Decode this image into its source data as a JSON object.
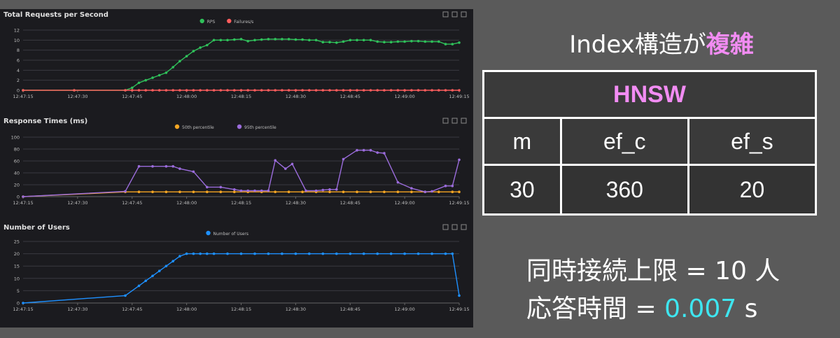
{
  "slide": {
    "title_prefix": "Index構造が",
    "title_highlight": "複雑",
    "table": {
      "header": "HNSW",
      "columns": [
        "m",
        "ef_c",
        "ef_s"
      ],
      "values": [
        "30",
        "360",
        "20"
      ]
    },
    "info1": "同時接続上限 = 10 人",
    "info2_prefix": "応答時間 = ",
    "info2_value": "0.007",
    "info2_suffix": " s"
  },
  "colors": {
    "rps": "#2fc15a",
    "failures": "#ff5d5d",
    "p50": "#f5a623",
    "p95": "#9b6cdc",
    "users": "#1e90ff",
    "highlight": "#f28cf3",
    "cyan": "#3ee6f0"
  },
  "chart_data": [
    {
      "type": "line",
      "title": "Total Requests per Second",
      "ylim": [
        0,
        12
      ],
      "yticks": [
        0,
        2,
        4,
        6,
        8,
        10,
        12
      ],
      "xticks": [
        "12:47:15",
        "12:47:30",
        "12:47:45",
        "12:48:00",
        "12:48:15",
        "12:48:30",
        "12:48:45",
        "12:49:00",
        "12:49:15"
      ],
      "grid": true,
      "legend": "top-center",
      "series": [
        {
          "name": "RPS",
          "color": "#2fc15a",
          "points": [
            [
              0,
              0
            ],
            [
              15,
              0
            ],
            [
              30,
              0
            ],
            [
              32,
              0.5
            ],
            [
              34,
              1.5
            ],
            [
              36,
              2
            ],
            [
              38,
              2.5
            ],
            [
              40,
              3
            ],
            [
              42,
              3.5
            ],
            [
              44,
              4.6
            ],
            [
              46,
              5.8
            ],
            [
              48,
              6.8
            ],
            [
              50,
              7.8
            ],
            [
              52,
              8.5
            ],
            [
              54,
              9
            ],
            [
              56,
              10
            ],
            [
              58,
              10
            ],
            [
              60,
              10
            ],
            [
              62,
              10.1
            ],
            [
              64,
              10.2
            ],
            [
              66,
              9.8
            ],
            [
              68,
              10
            ],
            [
              70,
              10.1
            ],
            [
              72,
              10.2
            ],
            [
              74,
              10.2
            ],
            [
              76,
              10.2
            ],
            [
              78,
              10.2
            ],
            [
              80,
              10.1
            ],
            [
              82,
              10.1
            ],
            [
              84,
              10
            ],
            [
              86,
              10
            ],
            [
              88,
              9.6
            ],
            [
              90,
              9.6
            ],
            [
              92,
              9.5
            ],
            [
              94,
              9.7
            ],
            [
              96,
              10
            ],
            [
              98,
              10
            ],
            [
              100,
              10
            ],
            [
              102,
              10
            ],
            [
              104,
              9.7
            ],
            [
              106,
              9.6
            ],
            [
              108,
              9.6
            ],
            [
              110,
              9.7
            ],
            [
              112,
              9.7
            ],
            [
              114,
              9.8
            ],
            [
              116,
              9.8
            ],
            [
              118,
              9.7
            ],
            [
              120,
              9.7
            ],
            [
              122,
              9.7
            ],
            [
              124,
              9.2
            ],
            [
              126,
              9.2
            ],
            [
              128,
              9.5
            ]
          ]
        },
        {
          "name": "Failures/s",
          "color": "#ff5d5d",
          "points": [
            [
              0,
              0
            ],
            [
              15,
              0
            ],
            [
              30,
              0
            ],
            [
              32,
              0
            ],
            [
              34,
              0
            ],
            [
              36,
              0
            ],
            [
              38,
              0
            ],
            [
              40,
              0
            ],
            [
              42,
              0
            ],
            [
              44,
              0
            ],
            [
              46,
              0
            ],
            [
              48,
              0
            ],
            [
              50,
              0
            ],
            [
              52,
              0
            ],
            [
              54,
              0
            ],
            [
              56,
              0
            ],
            [
              58,
              0
            ],
            [
              60,
              0
            ],
            [
              62,
              0
            ],
            [
              64,
              0
            ],
            [
              66,
              0
            ],
            [
              68,
              0
            ],
            [
              70,
              0
            ],
            [
              72,
              0
            ],
            [
              74,
              0
            ],
            [
              76,
              0
            ],
            [
              78,
              0
            ],
            [
              80,
              0
            ],
            [
              82,
              0
            ],
            [
              84,
              0
            ],
            [
              86,
              0
            ],
            [
              88,
              0
            ],
            [
              90,
              0
            ],
            [
              92,
              0
            ],
            [
              94,
              0
            ],
            [
              96,
              0
            ],
            [
              98,
              0
            ],
            [
              100,
              0
            ],
            [
              102,
              0
            ],
            [
              104,
              0
            ],
            [
              106,
              0
            ],
            [
              108,
              0
            ],
            [
              110,
              0
            ],
            [
              112,
              0
            ],
            [
              114,
              0
            ],
            [
              116,
              0
            ],
            [
              118,
              0
            ],
            [
              120,
              0
            ],
            [
              122,
              0
            ],
            [
              124,
              0
            ],
            [
              126,
              0
            ],
            [
              128,
              0
            ]
          ]
        }
      ]
    },
    {
      "type": "line",
      "title": "Response Times (ms)",
      "ylim": [
        0,
        100
      ],
      "yticks": [
        0,
        20,
        40,
        60,
        80,
        100
      ],
      "xticks": [
        "12:47:15",
        "12:47:30",
        "12:47:45",
        "12:48:00",
        "12:48:15",
        "12:48:30",
        "12:48:45",
        "12:49:00",
        "12:49:15"
      ],
      "grid": true,
      "legend": "top-center",
      "series": [
        {
          "name": "50th percentile",
          "color": "#f5a623",
          "points": [
            [
              0,
              0
            ],
            [
              30,
              8
            ],
            [
              34,
              8
            ],
            [
              38,
              8
            ],
            [
              42,
              8
            ],
            [
              46,
              8
            ],
            [
              50,
              8
            ],
            [
              54,
              8
            ],
            [
              58,
              8
            ],
            [
              62,
              8
            ],
            [
              66,
              8
            ],
            [
              70,
              8
            ],
            [
              74,
              8
            ],
            [
              78,
              8
            ],
            [
              82,
              8
            ],
            [
              86,
              8
            ],
            [
              90,
              8
            ],
            [
              94,
              8
            ],
            [
              98,
              8
            ],
            [
              102,
              8
            ],
            [
              106,
              8
            ],
            [
              110,
              8
            ],
            [
              114,
              8
            ],
            [
              118,
              8
            ],
            [
              122,
              8
            ],
            [
              126,
              8
            ],
            [
              128,
              8
            ]
          ]
        },
        {
          "name": "95th percentile",
          "color": "#9b6cdc",
          "points": [
            [
              0,
              0
            ],
            [
              30,
              9
            ],
            [
              34,
              51
            ],
            [
              38,
              51
            ],
            [
              42,
              51
            ],
            [
              44,
              51
            ],
            [
              46,
              47
            ],
            [
              50,
              42
            ],
            [
              54,
              16
            ],
            [
              58,
              16
            ],
            [
              62,
              12
            ],
            [
              64,
              10
            ],
            [
              66,
              10
            ],
            [
              68,
              10
            ],
            [
              70,
              10
            ],
            [
              72,
              10
            ],
            [
              74,
              61
            ],
            [
              77,
              47
            ],
            [
              79,
              55
            ],
            [
              83,
              10
            ],
            [
              86,
              10
            ],
            [
              88,
              11
            ],
            [
              90,
              12
            ],
            [
              92,
              12
            ],
            [
              94,
              63
            ],
            [
              98,
              78
            ],
            [
              100,
              78
            ],
            [
              102,
              78
            ],
            [
              104,
              74
            ],
            [
              106,
              73
            ],
            [
              110,
              24
            ],
            [
              114,
              14
            ],
            [
              118,
              8
            ],
            [
              120,
              9
            ],
            [
              124,
              18
            ],
            [
              126,
              18
            ],
            [
              128,
              62
            ]
          ]
        }
      ]
    },
    {
      "type": "line",
      "title": "Number of Users",
      "ylim": [
        0,
        25
      ],
      "yticks": [
        0,
        5,
        10,
        15,
        20,
        25
      ],
      "xticks": [
        "12:47:15",
        "12:47:30",
        "12:47:45",
        "12:48:00",
        "12:48:15",
        "12:48:30",
        "12:48:45",
        "12:49:00",
        "12:49:15"
      ],
      "grid": true,
      "legend": "top-center",
      "series": [
        {
          "name": "Number of Users",
          "color": "#1e90ff",
          "points": [
            [
              0,
              0
            ],
            [
              30,
              3
            ],
            [
              34,
              7
            ],
            [
              36,
              9
            ],
            [
              38,
              11
            ],
            [
              40,
              13
            ],
            [
              42,
              15
            ],
            [
              44,
              17
            ],
            [
              46,
              19
            ],
            [
              48,
              20
            ],
            [
              50,
              20
            ],
            [
              52,
              20
            ],
            [
              54,
              20
            ],
            [
              56,
              20
            ],
            [
              60,
              20
            ],
            [
              64,
              20
            ],
            [
              68,
              20
            ],
            [
              72,
              20
            ],
            [
              76,
              20
            ],
            [
              80,
              20
            ],
            [
              84,
              20
            ],
            [
              88,
              20
            ],
            [
              92,
              20
            ],
            [
              96,
              20
            ],
            [
              100,
              20
            ],
            [
              104,
              20
            ],
            [
              108,
              20
            ],
            [
              112,
              20
            ],
            [
              116,
              20
            ],
            [
              120,
              20
            ],
            [
              124,
              20
            ],
            [
              126,
              20
            ],
            [
              128,
              3
            ]
          ]
        }
      ]
    }
  ]
}
